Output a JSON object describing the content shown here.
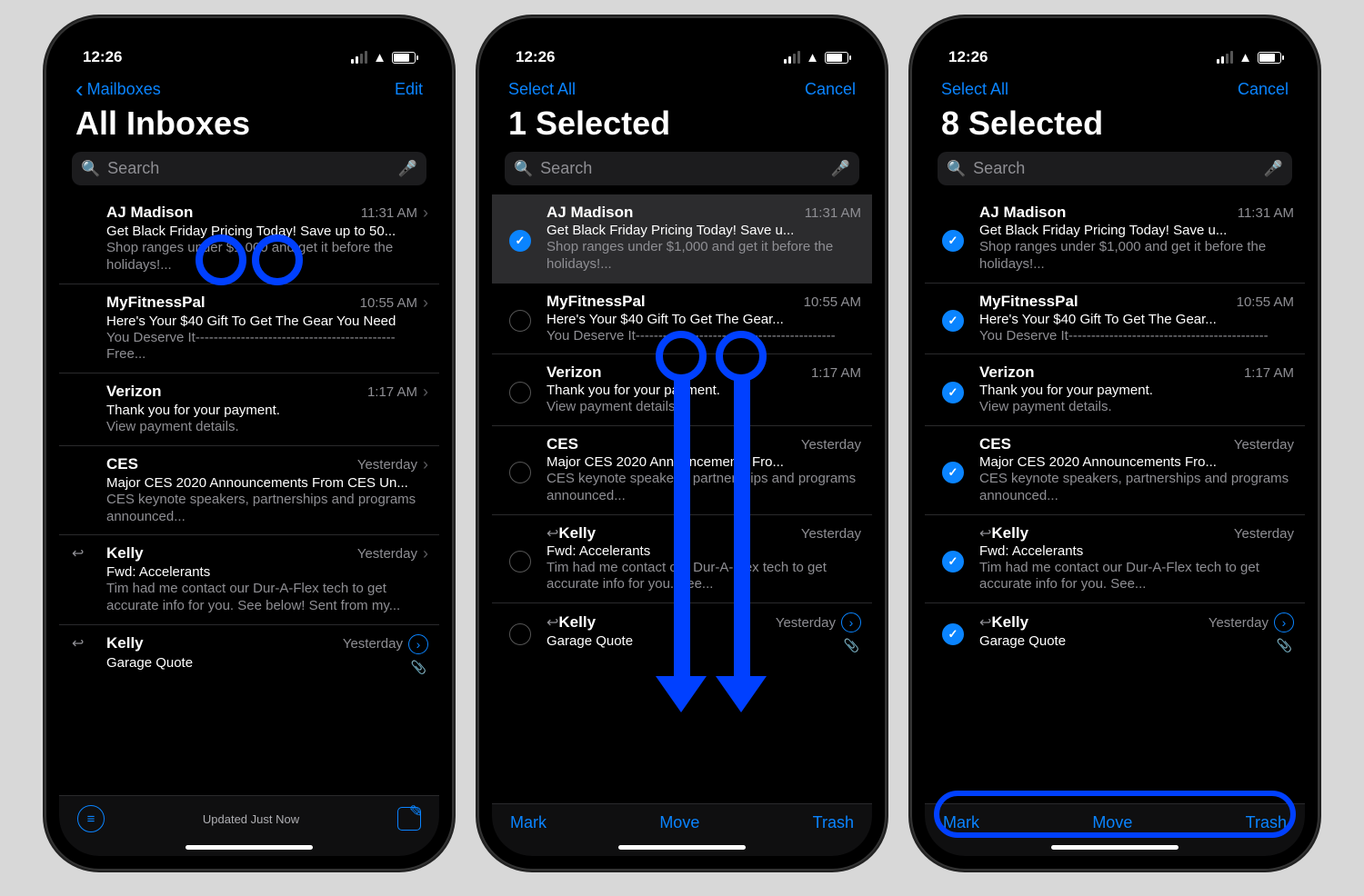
{
  "status": {
    "time": "12:26"
  },
  "accent": "#0a84ff",
  "screens": [
    {
      "nav_left": "Mailboxes",
      "nav_left_chevron": true,
      "nav_right": "Edit",
      "title": "All Inboxes",
      "search_placeholder": "Search",
      "footer_mode": "status",
      "footer_status": "Updated Just Now",
      "edit_mode": false,
      "rows": [
        {
          "sender": "AJ Madison",
          "time": "11:31 AM",
          "subject": "Get Black Friday Pricing Today! Save up to 50...",
          "preview": "Shop ranges under $1,000 and get it before the holidays!...",
          "chevron": true
        },
        {
          "sender": "MyFitnessPal",
          "time": "10:55 AM",
          "subject": "Here's Your $40 Gift To Get The Gear You Need",
          "preview": "You Deserve It-------------------------------------------- Free...",
          "chevron": true
        },
        {
          "sender": "Verizon",
          "time": "1:17 AM",
          "subject": "Thank you for your payment.",
          "preview": "View payment details.",
          "chevron": true
        },
        {
          "sender": "CES",
          "time": "Yesterday",
          "subject": "Major CES 2020 Announcements From CES Un...",
          "preview": "CES keynote speakers, partnerships and programs announced...",
          "chevron": true
        },
        {
          "sender": "Kelly",
          "time": "Yesterday",
          "subject": "Fwd: Accelerants",
          "preview": "Tim had me contact our Dur-A-Flex tech to get accurate info for you. See below! Sent from my...",
          "chevron": true,
          "reply": true
        },
        {
          "sender": "Kelly",
          "time": "Yesterday",
          "subject": "Garage Quote",
          "preview": "",
          "reply": true,
          "thread": true,
          "attach": true
        }
      ]
    },
    {
      "nav_left": "Select All",
      "nav_right": "Cancel",
      "title": "1 Selected",
      "search_placeholder": "Search",
      "footer_mode": "actions",
      "footer_mark": "Mark",
      "footer_move": "Move",
      "footer_trash": "Trash",
      "edit_mode": true,
      "rows": [
        {
          "sender": "AJ Madison",
          "time": "11:31 AM",
          "subject": "Get Black Friday Pricing Today! Save u...",
          "preview": "Shop ranges under $1,000 and get it before the holidays!...",
          "checked": true,
          "selbg": true
        },
        {
          "sender": "MyFitnessPal",
          "time": "10:55 AM",
          "subject": "Here's Your $40 Gift To Get The Gear...",
          "preview": "You Deserve It--------------------------------------------",
          "checked": false
        },
        {
          "sender": "Verizon",
          "time": "1:17 AM",
          "subject": "Thank you for your payment.",
          "preview": "View payment details.",
          "checked": false
        },
        {
          "sender": "CES",
          "time": "Yesterday",
          "subject": "Major CES 2020 Announcements Fro...",
          "preview": "CES keynote speakers, partnerships and programs announced...",
          "checked": false
        },
        {
          "sender": "Kelly",
          "time": "Yesterday",
          "subject": "Fwd: Accelerants",
          "preview": "Tim had me contact our Dur-A-Flex tech to get accurate info for you. See...",
          "checked": false,
          "reply": true
        },
        {
          "sender": "Kelly",
          "time": "Yesterday",
          "subject": "Garage Quote",
          "preview": "",
          "reply": true,
          "thread": true,
          "attach": true,
          "checked": false
        }
      ]
    },
    {
      "nav_left": "Select All",
      "nav_right": "Cancel",
      "title": "8 Selected",
      "search_placeholder": "Search",
      "footer_mode": "actions",
      "footer_mark": "Mark",
      "footer_move": "Move",
      "footer_trash": "Trash",
      "edit_mode": true,
      "rows": [
        {
          "sender": "AJ Madison",
          "time": "11:31 AM",
          "subject": "Get Black Friday Pricing Today! Save u...",
          "preview": "Shop ranges under $1,000 and get it before the holidays!...",
          "checked": true
        },
        {
          "sender": "MyFitnessPal",
          "time": "10:55 AM",
          "subject": "Here's Your $40 Gift To Get The Gear...",
          "preview": "You Deserve It--------------------------------------------",
          "checked": true
        },
        {
          "sender": "Verizon",
          "time": "1:17 AM",
          "subject": "Thank you for your payment.",
          "preview": "View payment details.",
          "checked": true
        },
        {
          "sender": "CES",
          "time": "Yesterday",
          "subject": "Major CES 2020 Announcements Fro...",
          "preview": "CES keynote speakers, partnerships and programs announced...",
          "checked": true
        },
        {
          "sender": "Kelly",
          "time": "Yesterday",
          "subject": "Fwd: Accelerants",
          "preview": "Tim had me contact our Dur-A-Flex tech to get accurate info for you. See...",
          "checked": true,
          "reply": true
        },
        {
          "sender": "Kelly",
          "time": "Yesterday",
          "subject": "Garage Quote",
          "preview": "",
          "reply": true,
          "thread": true,
          "attach": true,
          "checked": true
        }
      ]
    }
  ]
}
